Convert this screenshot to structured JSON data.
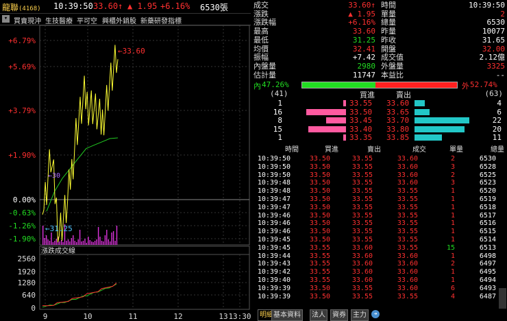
{
  "header": {
    "stock_name": "龍聯",
    "stock_code": "(4168)",
    "time": "10:39:50",
    "price": "33.60↑",
    "change": "▲ 1.95",
    "change_pct": "+6.16%",
    "volume": "6530張"
  },
  "toolbar": {
    "items": [
      "買賣現沖",
      "生技醫療",
      "平可空",
      "興櫃外銷股",
      "新藥研發指標"
    ]
  },
  "chart": {
    "price_axis_labels": [
      {
        "text": "+6.79%",
        "color": "#ff3030"
      },
      {
        "text": "+5.69%",
        "color": "#ff3030"
      },
      {
        "text": "+3.79%",
        "color": "#ff3030"
      },
      {
        "text": "+1.90%",
        "color": "#ff3030"
      },
      {
        "text": "0.00%",
        "color": "#ffffff"
      },
      {
        "text": "-0.63%",
        "color": "#22dd22"
      },
      {
        "text": "-1.26%",
        "color": "#22dd22"
      },
      {
        "text": "-1.90%",
        "color": "#22dd22"
      }
    ],
    "annotation_high": "←33.60",
    "annotation_avg": "←30",
    "annotation_low": "←31.25",
    "volume_panel_title": "漲跌成交線",
    "volume_axis_labels": [
      "2560",
      "1920",
      "1280",
      "640",
      "0"
    ],
    "time_axis_labels": [
      "9",
      "10",
      "11",
      "12",
      "13",
      "13:30"
    ]
  },
  "chart_data": {
    "type": "line",
    "title": "",
    "xlabel": "",
    "ylabel": "",
    "x_ticks": [
      "9",
      "10",
      "11",
      "12",
      "13",
      "13:30"
    ],
    "series": [
      {
        "values": [
          31.25,
          32.1,
          31.0,
          31.4,
          32.5,
          33.0,
          32.9,
          32.6,
          33.2,
          33.6
        ]
      },
      {
        "values": [
          31.3,
          31.6,
          31.8,
          31.95,
          32.1,
          32.25,
          32.3,
          32.35,
          32.4,
          32.41
        ]
      }
    ],
    "ylim": [
      31.0,
      33.8
    ],
    "colors": {
      "price": "#ffff33",
      "avg": "#22cc22",
      "volume": "#dd33dd"
    }
  },
  "quote": {
    "left": [
      {
        "label": "成交",
        "value": "33.60↑",
        "color": "#ff3030"
      },
      {
        "label": "漲跌",
        "value": "▲ 1.95",
        "color": "#ff3030"
      },
      {
        "label": "漲跌幅",
        "value": "+6.16%",
        "color": "#ff3030"
      },
      {
        "label": "最高",
        "value": "33.60",
        "color": "#ff3030"
      },
      {
        "label": "最低",
        "value": "31.25",
        "color": "#22dd22"
      },
      {
        "label": "均價",
        "value": "32.41",
        "color": "#ff3030"
      },
      {
        "label": "振幅",
        "value": "+7.42",
        "color": "#ffffff"
      },
      {
        "label": "內盤量",
        "value": "2980",
        "color": "#22dd22"
      },
      {
        "label": "估計量",
        "value": "11747",
        "color": "#ffffff"
      }
    ],
    "right": [
      {
        "label": "時間",
        "value": "10:39:50",
        "color": "#ffffff"
      },
      {
        "label": "單量",
        "value": "2",
        "color": "#ff3030"
      },
      {
        "label": "總量",
        "value": "6530",
        "color": "#ffffff"
      },
      {
        "label": "昨量",
        "value": "10077",
        "color": "#ffffff"
      },
      {
        "label": "昨收",
        "value": "31.65",
        "color": "#ffffff"
      },
      {
        "label": "開盤",
        "value": "32.00",
        "color": "#ff3030"
      },
      {
        "label": "成交值",
        "value": "2.12億",
        "color": "#ffffff"
      },
      {
        "label": "外盤量",
        "value": "3325",
        "color": "#ff3030"
      },
      {
        "label": "本益比",
        "value": "--",
        "color": "#ffffff"
      }
    ]
  },
  "ratio": {
    "inner_label": "內",
    "inner_pct": "47.26%",
    "inner_value": 47.26,
    "outer_label": "外",
    "outer_pct": "52.74%",
    "outer_value": 52.74
  },
  "book": {
    "bid_total": "(41)",
    "ask_total": "(63)",
    "bid_header": "買進",
    "ask_header": "賣出",
    "rows": [
      {
        "bid_qty": "1",
        "bid": "33.55",
        "ask": "33.60",
        "ask_qty": "4",
        "bq": 1,
        "aq": 4
      },
      {
        "bid_qty": "16",
        "bid": "33.50",
        "ask": "33.65",
        "ask_qty": "6",
        "bq": 16,
        "aq": 6
      },
      {
        "bid_qty": "8",
        "bid": "33.45",
        "ask": "33.70",
        "ask_qty": "22",
        "bq": 8,
        "aq": 22
      },
      {
        "bid_qty": "15",
        "bid": "33.40",
        "ask": "33.80",
        "ask_qty": "20",
        "bq": 15,
        "aq": 20
      },
      {
        "bid_qty": "1",
        "bid": "33.35",
        "ask": "33.85",
        "ask_qty": "11",
        "bq": 1,
        "aq": 11
      }
    ]
  },
  "ticks": {
    "headers": [
      "時間",
      "買進",
      "賣出",
      "成交",
      "單量",
      "總量"
    ],
    "rows": [
      [
        "10:39:50",
        "33.50",
        "33.55",
        "33.60",
        "2",
        "6530",
        "r"
      ],
      [
        "10:39:50",
        "33.50",
        "33.55",
        "33.60",
        "3",
        "6528",
        "r"
      ],
      [
        "10:39:50",
        "33.50",
        "33.55",
        "33.60",
        "2",
        "6525",
        "r"
      ],
      [
        "10:39:48",
        "33.50",
        "33.55",
        "33.60",
        "3",
        "6523",
        "r"
      ],
      [
        "10:39:48",
        "33.50",
        "33.55",
        "33.55",
        "1",
        "6520",
        "r"
      ],
      [
        "10:39:47",
        "33.50",
        "33.55",
        "33.55",
        "1",
        "6519",
        "r"
      ],
      [
        "10:39:47",
        "33.50",
        "33.55",
        "33.55",
        "1",
        "6518",
        "r"
      ],
      [
        "10:39:46",
        "33.50",
        "33.55",
        "33.55",
        "1",
        "6517",
        "r"
      ],
      [
        "10:39:46",
        "33.50",
        "33.55",
        "33.55",
        "1",
        "6516",
        "r"
      ],
      [
        "10:39:46",
        "33.50",
        "33.55",
        "33.55",
        "1",
        "6515",
        "r"
      ],
      [
        "10:39:45",
        "33.50",
        "33.55",
        "33.55",
        "1",
        "6514",
        "r"
      ],
      [
        "10:39:45",
        "33.55",
        "33.60",
        "33.55",
        "15",
        "6513",
        "g"
      ],
      [
        "10:39:44",
        "33.55",
        "33.60",
        "33.60",
        "1",
        "6498",
        "r"
      ],
      [
        "10:39:43",
        "33.55",
        "33.60",
        "33.60",
        "2",
        "6497",
        "r"
      ],
      [
        "10:39:42",
        "33.55",
        "33.60",
        "33.60",
        "1",
        "6495",
        "r"
      ],
      [
        "10:39:40",
        "33.55",
        "33.60",
        "33.60",
        "1",
        "6494",
        "r"
      ],
      [
        "10:39:39",
        "33.50",
        "33.55",
        "33.60",
        "6",
        "6493",
        "r"
      ],
      [
        "10:39:39",
        "33.50",
        "33.55",
        "33.55",
        "4",
        "6487",
        "r"
      ]
    ]
  },
  "tabs": [
    "明細",
    "基本資料",
    "法人",
    "資券",
    "主力"
  ]
}
